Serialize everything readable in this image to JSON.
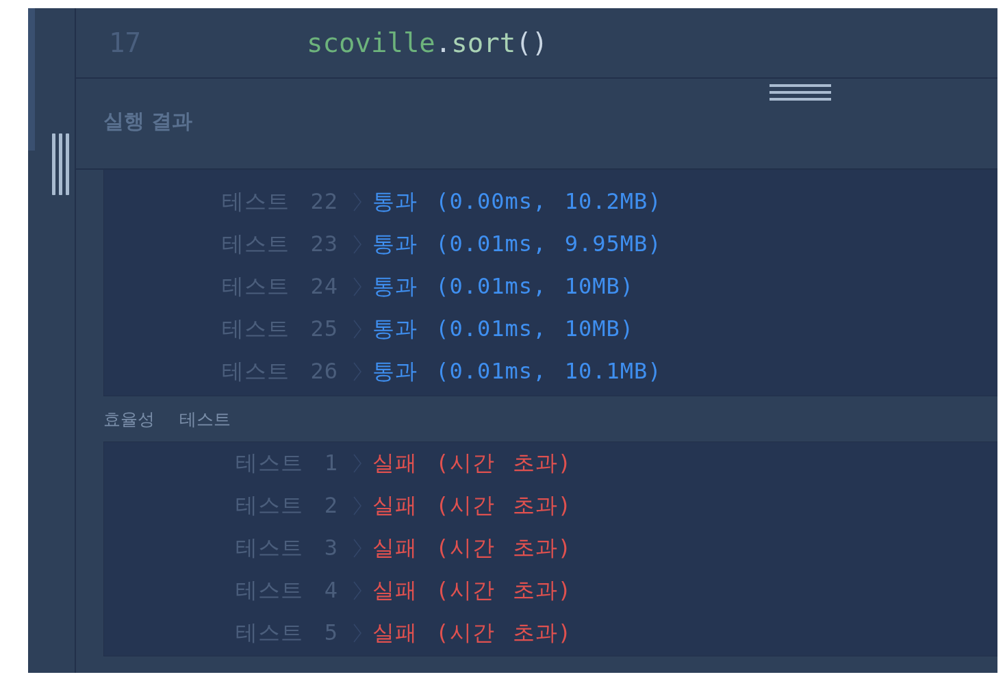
{
  "editor": {
    "lines": [
      {
        "number": "17",
        "tokens": [
          {
            "kind": "identifier",
            "text": "scoville"
          },
          {
            "kind": "punct",
            "text": "."
          },
          {
            "kind": "method",
            "text": "sort"
          },
          {
            "kind": "punct",
            "text": "()"
          }
        ]
      }
    ]
  },
  "results": {
    "title": "실행 결과",
    "sections": [
      {
        "tests": [
          {
            "label": "테스트 22",
            "kind": "pass",
            "result": "통과 (0.00ms, 10.2MB)"
          },
          {
            "label": "테스트 23",
            "kind": "pass",
            "result": "통과 (0.01ms, 9.95MB)"
          },
          {
            "label": "테스트 24",
            "kind": "pass",
            "result": "통과 (0.01ms, 10MB)"
          },
          {
            "label": "테스트 25",
            "kind": "pass",
            "result": "통과 (0.01ms, 10MB)"
          },
          {
            "label": "테스트 26",
            "kind": "pass",
            "result": "통과 (0.01ms, 10.1MB)"
          }
        ]
      },
      {
        "heading": "효율성 테스트",
        "tests": [
          {
            "label": "테스트 1",
            "kind": "fail",
            "result": "실패 (시간 초과)"
          },
          {
            "label": "테스트 2",
            "kind": "fail",
            "result": "실패 (시간 초과)"
          },
          {
            "label": "테스트 3",
            "kind": "fail",
            "result": "실패 (시간 초과)"
          },
          {
            "label": "테스트 4",
            "kind": "fail",
            "result": "실패 (시간 초과)"
          },
          {
            "label": "테스트 5",
            "kind": "fail",
            "result": "실패 (시간 초과)"
          }
        ]
      }
    ]
  }
}
